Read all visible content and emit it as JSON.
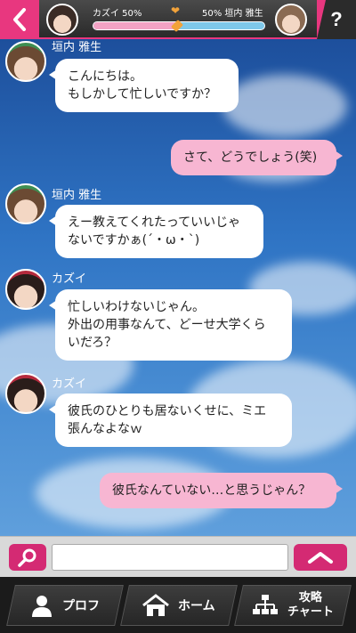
{
  "header": {
    "left_label": "カズイ 50%",
    "right_label": "50% 垣内 雅生",
    "affection_percent": 50,
    "help_label": "?"
  },
  "messages": [
    {
      "side": "left",
      "sender": "垣内 雅生",
      "avatar": "gaki",
      "text": "こんにちは。\nもしかして忙しいですか？"
    },
    {
      "side": "right",
      "text": "さて、どうでしょう(笑)"
    },
    {
      "side": "left",
      "sender": "垣内 雅生",
      "avatar": "gaki",
      "text": "えー教えてくれたっていいじゃ\nないですかぁ(´・ω・`)"
    },
    {
      "side": "left",
      "sender": "カズイ",
      "avatar": "kazui",
      "text": "忙しいわけないじゃん。\n外出の用事なんて、どーせ大学くら\nいだろ？"
    },
    {
      "side": "left",
      "sender": "カズイ",
      "avatar": "kazui",
      "text": "彼氏のひとりも居ないくせに、ミエ\n張んなよなｗ"
    },
    {
      "side": "right",
      "text": "彼氏なんていない…と思うじゃん？"
    }
  ],
  "input": {
    "value": "",
    "placeholder": ""
  },
  "nav": {
    "profile": "プロフ",
    "home": "ホーム",
    "chart": "攻略\nチャート"
  },
  "colors": {
    "accent": "#e8377f",
    "bubble_me": "#f7b6d2",
    "bubble_other": "#ffffff"
  }
}
